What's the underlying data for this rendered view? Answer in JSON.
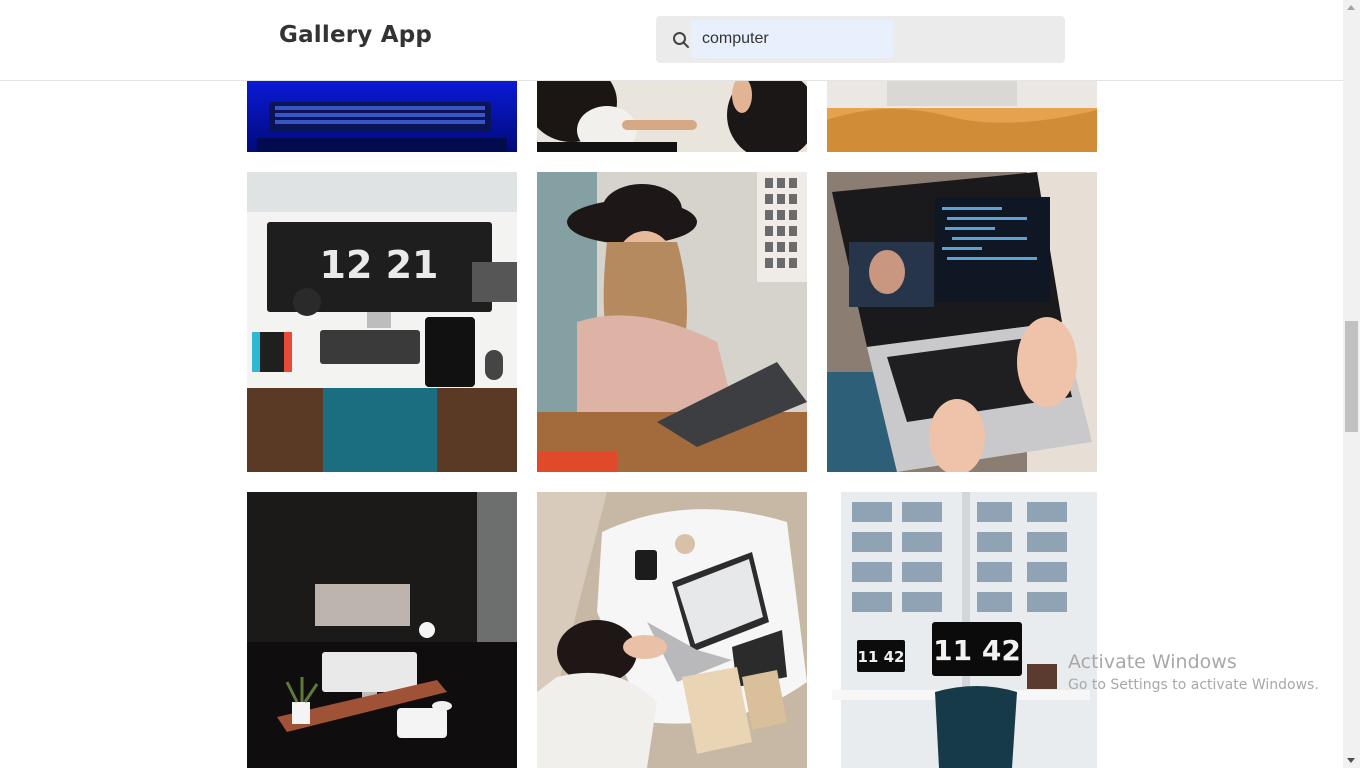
{
  "header": {
    "app_title": "Gallery App"
  },
  "search": {
    "icon": "search-icon",
    "value": "computer"
  },
  "gallery": {
    "photos": [
      {
        "description": "keyboard-under-blue-light"
      },
      {
        "description": "people-at-table-overhead"
      },
      {
        "description": "laptop-on-orange-bed"
      },
      {
        "description": "desk-setup-with-clock-monitor"
      },
      {
        "description": "woman-in-hat-with-laptop"
      },
      {
        "description": "typing-on-laptop-video-call"
      },
      {
        "description": "dark-room-imac-desk"
      },
      {
        "description": "woman-with-laptop-and-books"
      },
      {
        "description": "office-window-clock-displays"
      }
    ]
  },
  "watermark": {
    "line1": "Activate Windows",
    "line2": "Go to Settings to activate Windows."
  }
}
